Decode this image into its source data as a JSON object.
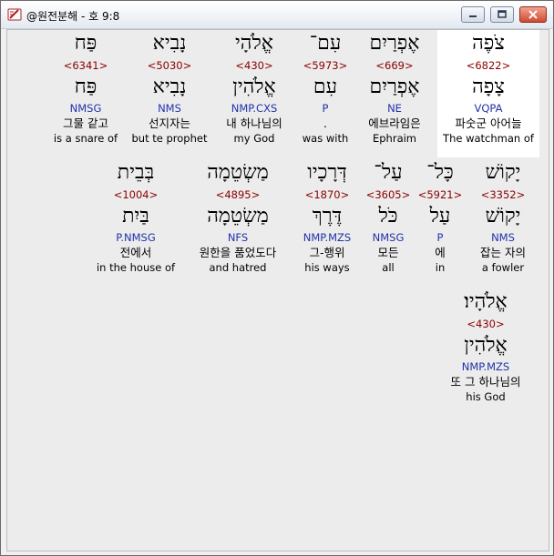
{
  "window": {
    "title": "@원전분해 - 호 9:8",
    "minimize_icon": "minimize-icon",
    "maximize_icon": "maximize-icon",
    "close_icon": "close-icon",
    "app_icon": "bible-app-icon"
  },
  "colors": {
    "strong_number": "#8b0000",
    "parsing": "#2233aa",
    "selected_background": "#ffffff",
    "content_background": "#ececec"
  },
  "rows": [
    {
      "words": [
        {
          "heb": "פַּח",
          "num": "<6341>",
          "lemma": "פַּח",
          "parse": "NMSG",
          "kor": "그물 같고",
          "eng": "is a snare of"
        },
        {
          "heb": "נָבִיא",
          "num": "<5030>",
          "lemma": "נָבִיא",
          "parse": "NMS",
          "kor": "선지자는",
          "eng": "but te prophet"
        },
        {
          "heb": "אֱלֹהָי",
          "num": "<430>",
          "lemma": "אֱלֹהִין",
          "parse": "NMP.CXS",
          "kor": "내 하나님의",
          "eng": "my God"
        },
        {
          "heb": "עִם־",
          "num": "<5973>",
          "lemma": "עִם",
          "parse": "P",
          "kor": ".",
          "eng": "was with"
        },
        {
          "heb": "אֶפְרַיִם",
          "num": "<669>",
          "lemma": "אֶפְרַיִם",
          "parse": "NE",
          "kor": "에브라임은",
          "eng": "Ephraim"
        },
        {
          "heb": "צֹפֶה",
          "num": "<6822>",
          "lemma": "צָפָה",
          "parse": "VQPA",
          "kor": "파숫군 아어늘",
          "eng": "The watchman of",
          "selected": true
        }
      ]
    },
    {
      "words": [
        {
          "heb": "בְּבֵית",
          "num": "<1004>",
          "lemma": "בַּיִת",
          "parse": "P.NMSG",
          "kor": "전에서",
          "eng": "in the house of"
        },
        {
          "heb": "מַשְׂטֵמָה",
          "num": "<4895>",
          "lemma": "מַשְׂטֵמָה",
          "parse": "NFS",
          "kor": "원한을 품었도다",
          "eng": "and hatred"
        },
        {
          "heb": "דְּרָכָיו",
          "num": "<1870>",
          "lemma": "דֶּרֶךְ",
          "parse": "NMP.MZS",
          "kor": "그-행위",
          "eng": "his ways"
        },
        {
          "heb": "עַל־",
          "num": "<3605>",
          "lemma": "כֹּל",
          "parse": "NMSG",
          "kor": "모든",
          "eng": "all"
        },
        {
          "heb": "כָּל־",
          "num": "<5921>",
          "lemma": "עַל",
          "parse": "P",
          "kor": "에",
          "eng": "in"
        },
        {
          "heb": "יָקוֹשׁ",
          "num": "<3352>",
          "lemma": "יָקוֹשׁ",
          "parse": "NMS",
          "kor": "잡는 자의",
          "eng": "a fowler"
        }
      ]
    },
    {
      "words": [
        {
          "heb": "אֱלֹהָיו׃",
          "num": "<430>",
          "lemma": "אֱלֹהִין",
          "parse": "NMP.MZS",
          "kor": "또 그 하나님의",
          "eng": "his God"
        }
      ]
    }
  ]
}
